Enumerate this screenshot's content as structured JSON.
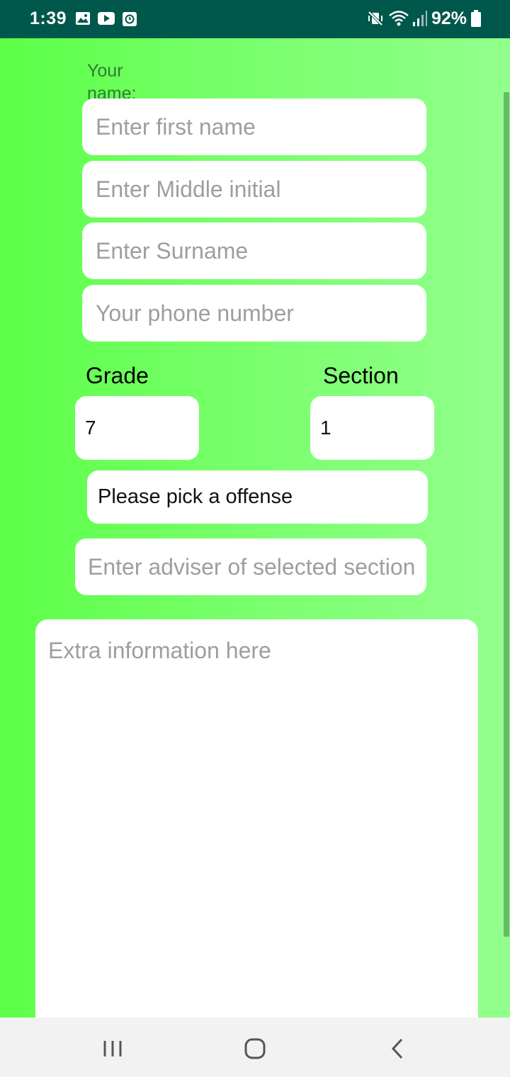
{
  "status_bar": {
    "time": "1:39",
    "battery": "92%",
    "icons": [
      "image-icon",
      "youtube-icon",
      "clock-icon",
      "mute-vibrate-icon",
      "wifi-icon",
      "signal-icon",
      "battery-icon"
    ]
  },
  "form": {
    "name_label": "Your name:",
    "first_name_placeholder": "Enter first name",
    "middle_initial_placeholder": "Enter Middle initial",
    "surname_placeholder": "Enter Surname",
    "phone_placeholder": "Your phone number",
    "grade_label": "Grade",
    "grade_value": "7",
    "section_label": "Section",
    "section_value": "1",
    "offense_selected": "Please pick a offense",
    "adviser_placeholder": "Enter adviser of selected section",
    "extra_placeholder": "Extra information here"
  },
  "navigation": {
    "buttons": [
      "recent-apps-icon",
      "home-icon",
      "back-icon"
    ]
  },
  "colors": {
    "status_bar_bg": "#00574b",
    "gradient_left": "#5cff47",
    "gradient_right": "#92ff8c",
    "label_green": "#2e7d32",
    "nav_bg": "#f2f2f2"
  }
}
